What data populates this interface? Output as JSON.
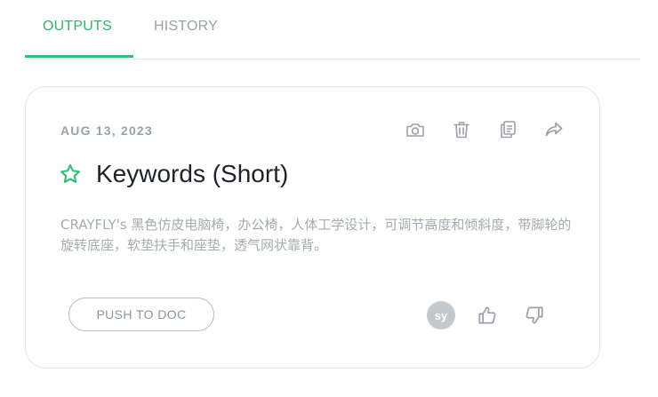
{
  "tabs": [
    {
      "label": "OUTPUTS",
      "active": true
    },
    {
      "label": "HISTORY",
      "active": false
    }
  ],
  "colors": {
    "accent": "#35c07a",
    "muted_text": "#9aa1a9",
    "title_text": "#1f2328"
  },
  "card": {
    "date": "AUG 13, 2023",
    "actions": [
      {
        "icon": "camera-icon"
      },
      {
        "icon": "trash-icon"
      },
      {
        "icon": "copy-icon"
      },
      {
        "icon": "share-icon"
      }
    ],
    "favorite_icon": "star-outline-icon",
    "title": "Keywords (Short)",
    "description": "CRAYFLY's 黑色仿皮电脑椅，办公椅，人体工学设计，可调节高度和倾斜度，带脚轮的旋转底座，软垫扶手和座垫，透气网状靠背。",
    "push_button": "PUSH TO DOC",
    "avatar_initials": "sy",
    "feedback": [
      {
        "icon": "thumbs-up-icon"
      },
      {
        "icon": "thumbs-down-icon"
      }
    ]
  }
}
